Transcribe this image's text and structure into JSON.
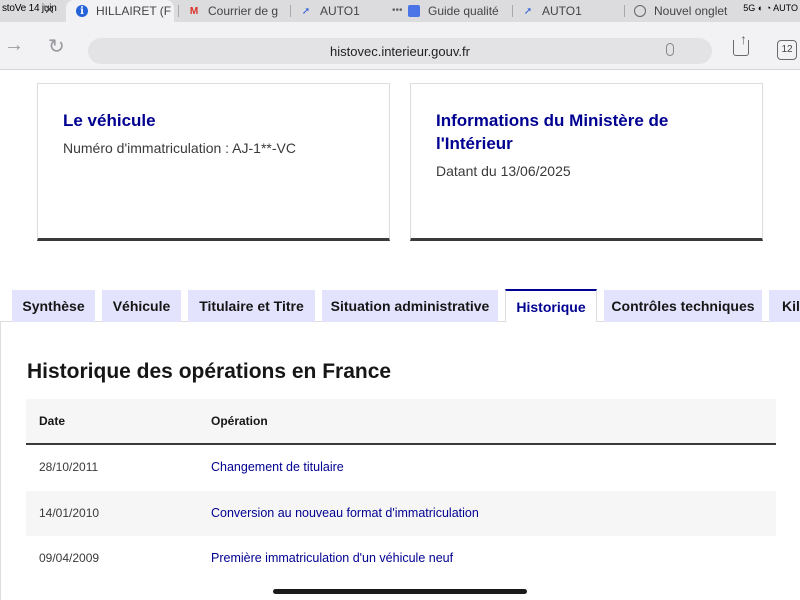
{
  "statusbar": {
    "time": "stoVe 14 juin",
    "right": "5G ◐ ◔ AUTO"
  },
  "browser_tabs": [
    {
      "label": "HILLAIRET (F",
      "icon": "info-icon"
    },
    {
      "label": "Courrier de g",
      "icon": "gmail-icon"
    },
    {
      "label": "AUTO1",
      "icon": "auto1-icon"
    },
    {
      "label": "Guide qualité",
      "icon": "doc-icon"
    },
    {
      "label": "AUTO1",
      "icon": "auto1-icon"
    },
    {
      "label": "Nouvel onglet",
      "icon": "globe-icon"
    }
  ],
  "addressbar": {
    "url": "histovec.interieur.gouv.fr",
    "tab_count": "12"
  },
  "vehicle_card": {
    "title": "Le véhicule",
    "text": "Numéro d'immatriculation : AJ-1**-VC"
  },
  "ministry_card": {
    "title": "Informations du Ministère de l'Intérieur",
    "text": "Datant du 13/06/2025"
  },
  "page_tabs": [
    {
      "label": "Synthèse"
    },
    {
      "label": "Véhicule"
    },
    {
      "label": "Titulaire et Titre"
    },
    {
      "label": "Situation administrative"
    },
    {
      "label": "Historique"
    },
    {
      "label": "Contrôles techniques"
    },
    {
      "label": "Kilométrage"
    }
  ],
  "active_tab": "Historique",
  "history": {
    "title": "Historique des opérations en France",
    "columns": {
      "date": "Date",
      "operation": "Opération"
    },
    "rows": [
      {
        "date": "28/10/2011",
        "operation": "Changement de titulaire"
      },
      {
        "date": "14/01/2010",
        "operation": "Conversion au nouveau format d'immatriculation"
      },
      {
        "date": "09/04/2009",
        "operation": "Première immatriculation d'un véhicule neuf"
      }
    ]
  },
  "colors": {
    "accent": "#000091",
    "tab_inactive_bg": "#e3e3fd",
    "table_alt_bg": "#f6f6f6"
  }
}
